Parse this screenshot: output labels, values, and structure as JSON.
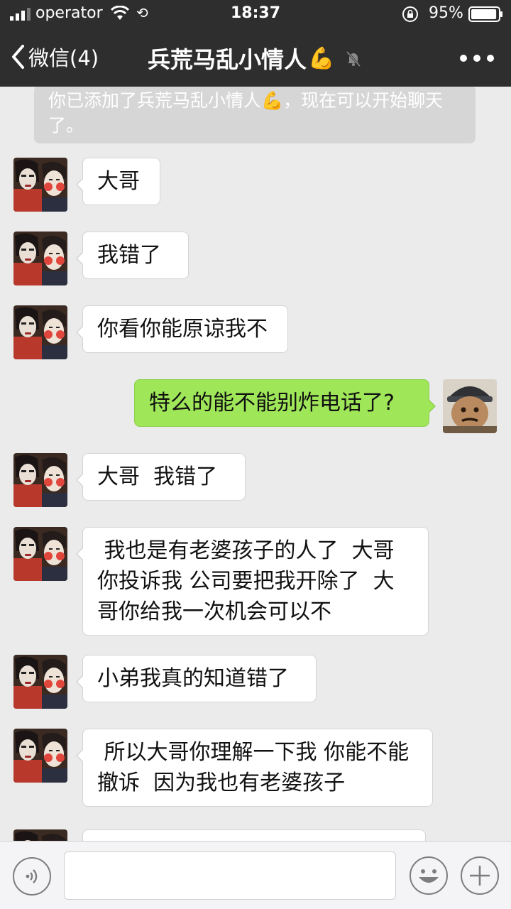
{
  "status_bar": {
    "carrier": "operator",
    "time": "18:37",
    "battery": "95%",
    "battery_level": 0.95
  },
  "nav": {
    "back_label": "微信(4)",
    "title": "兵荒马乱小情人",
    "title_emoji": "💪",
    "muted": true
  },
  "system_note": {
    "text_before": "你已添加了兵荒马乱小情人",
    "emoji": "💪",
    "text_after": "，现在可以开始聊天了。"
  },
  "messages": [
    {
      "side": "left",
      "text": "大哥"
    },
    {
      "side": "left",
      "text": "我错了"
    },
    {
      "side": "left",
      "text": "你看你能原谅我不"
    },
    {
      "side": "right",
      "text": "特么的能不能别炸电话了?"
    },
    {
      "side": "left",
      "text": "大哥  我错了"
    },
    {
      "side": "left",
      "text": " 我也是有老婆孩子的人了  大哥\n你投诉我 公司要把我开除了  大\n哥你给我一次机会可以不"
    },
    {
      "side": "left",
      "text": "小弟我真的知道错了"
    },
    {
      "side": "left",
      "text": " 所以大哥你理解一下我 你能不能\n撤诉  因为我也有老婆孩子"
    },
    {
      "side": "left",
      "text": ""
    }
  ],
  "input": {
    "value": "",
    "placeholder": ""
  },
  "colors": {
    "header_bg": "#2e2e2e",
    "chat_bg": "#ebebeb",
    "sent_bubble": "#9fe659",
    "received_bubble": "#ffffff"
  }
}
